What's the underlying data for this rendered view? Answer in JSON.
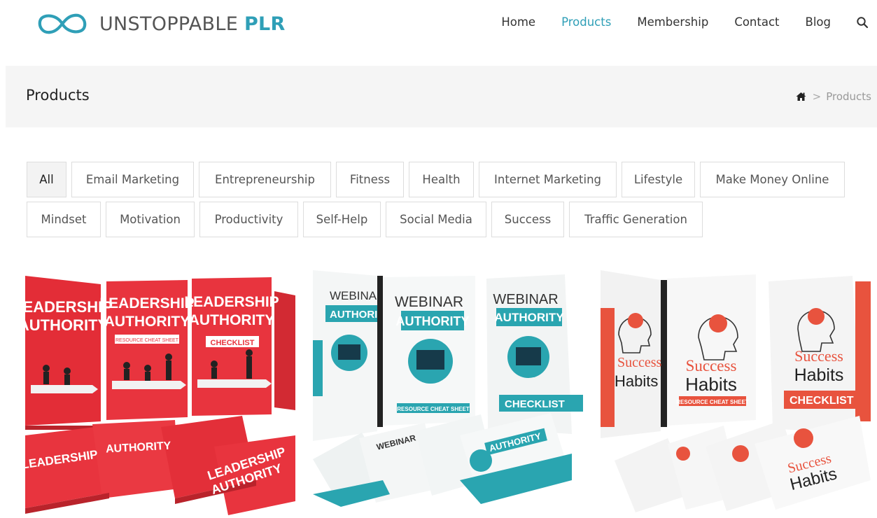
{
  "brand": {
    "name_light": "UNSTOPPABLE",
    "name_bold": "PLR",
    "accent": "#2f9fb7"
  },
  "nav": {
    "items": [
      {
        "label": "Home"
      },
      {
        "label": "Products",
        "active": true
      },
      {
        "label": "Membership"
      },
      {
        "label": "Contact"
      },
      {
        "label": "Blog"
      }
    ],
    "search_icon": "search-icon"
  },
  "page": {
    "title": "Products",
    "breadcrumb": {
      "home_icon": "home-icon",
      "separator": ">",
      "current": "Products"
    }
  },
  "filters": {
    "row1": [
      "All",
      "Email Marketing",
      "Entrepreneurship",
      "Fitness",
      "Health",
      "Internet Marketing",
      "Lifestyle",
      "Make Money Online"
    ],
    "row2": [
      "Mindset",
      "Motivation",
      "Productivity",
      "Self-Help",
      "Social Media",
      "Success",
      "Traffic Generation"
    ],
    "active": "All"
  },
  "products": [
    {
      "cover_line1": "LEADERSHIP",
      "cover_line2": "AUTHORITY",
      "sub_a": "RESOURCE CHEAT SHEET",
      "sub_b": "CHECKLIST",
      "color": "#e8343e"
    },
    {
      "cover_line1": "WEBINAR",
      "cover_line2": "AUTHORITY",
      "sub_a": "RESOURCE CHEAT SHEET",
      "sub_b": "CHECKLIST",
      "color": "#2aa5b0"
    },
    {
      "cover_line1": "Success",
      "cover_line2": "Habits",
      "sub_a": "RESOURCE CHEAT SHEET",
      "sub_b": "CHECKLIST",
      "color": "#e8533e"
    }
  ]
}
